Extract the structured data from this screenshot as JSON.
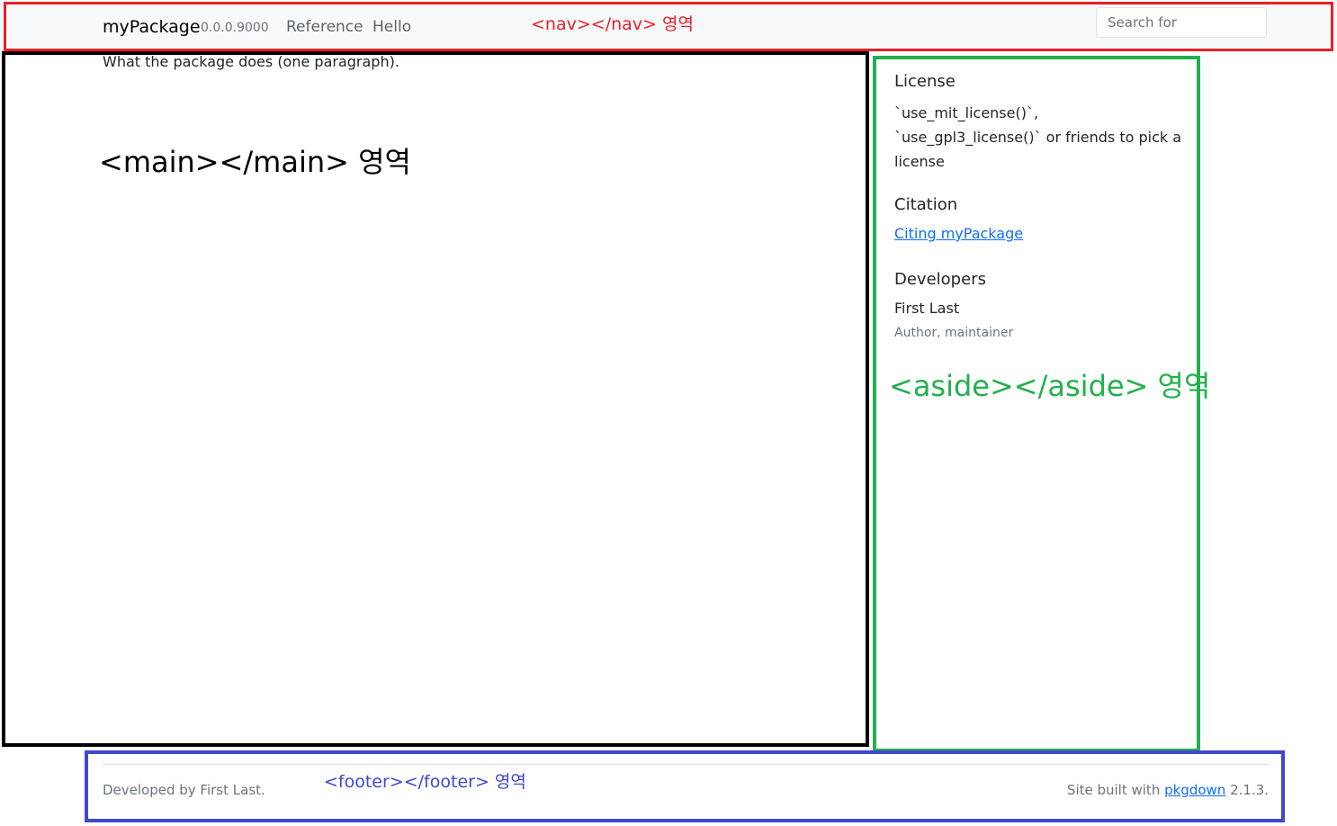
{
  "nav": {
    "brand": "myPackage",
    "version": "0.0.0.9000",
    "links": [
      {
        "label": "Reference"
      },
      {
        "label": "Hello"
      }
    ],
    "search_placeholder": "Search for"
  },
  "main": {
    "description": "What the package does (one paragraph)."
  },
  "aside": {
    "license_heading": "License",
    "license_text": "`use_mit_license()`, `use_gpl3_license()` or friends to pick a license",
    "citation_heading": "Citation",
    "citation_link": "Citing myPackage",
    "developers_heading": "Developers",
    "developer_name": "First Last",
    "developer_role": "Author, maintainer"
  },
  "footer": {
    "developed_by": "Developed by First Last.",
    "built_prefix": "Site built with ",
    "built_link": "pkgdown",
    "built_suffix": " 2.1.3."
  },
  "annotations": {
    "nav_label": "<nav></nav> 영역",
    "main_label": "<main></main> 영역",
    "aside_label": "<aside></aside> 영역",
    "footer_label": "<footer></footer> 영역",
    "colors": {
      "nav": "#e8202a",
      "main": "#000000",
      "aside": "#22b14c",
      "footer": "#3f48cc"
    }
  }
}
